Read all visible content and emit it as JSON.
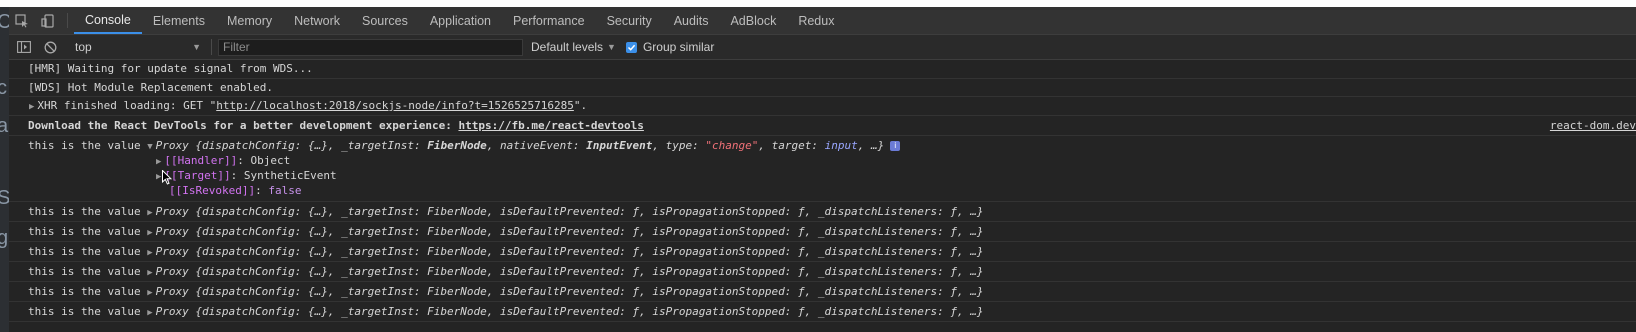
{
  "tabs": [
    "Console",
    "Elements",
    "Memory",
    "Network",
    "Sources",
    "Application",
    "Performance",
    "Security",
    "Audits",
    "AdBlock",
    "Redux"
  ],
  "toolbar": {
    "context": "top",
    "filter_placeholder": "Filter",
    "levels": "Default levels",
    "group_similar": "Group similar",
    "group_checked": true
  },
  "console": {
    "hmr": "[HMR] Waiting for update signal from WDS...",
    "wds": "[WDS] Hot Module Replacement enabled.",
    "xhr_prefix": "XHR finished loading: GET \"",
    "xhr_url": "http://localhost:2018/sockjs-node/info?t=1526525716285",
    "xhr_suffix": "\".",
    "devtools_text": "Download the React DevTools for a better development experience: ",
    "devtools_url": "https://fb.me/react-devtools",
    "devtools_source": "react-dom.dev",
    "value_label": "this is the value",
    "expanded": {
      "proxy": "Proxy",
      "preview": [
        {
          "k": "{dispatchConfig",
          "sep": ": ",
          "v": "{…}",
          "cls": "key"
        },
        {
          "k": ", _targetInst",
          "sep": ": ",
          "v": "FiberNode",
          "cls": "key"
        },
        {
          "k": ", nativeEvent",
          "sep": ": ",
          "v": "InputEvent",
          "cls": "key"
        },
        {
          "k": ", type",
          "sep": ": ",
          "v": "\"change\"",
          "cls": "str"
        },
        {
          "k": ", target",
          "sep": ": ",
          "v": "input",
          "cls": "tgt"
        },
        {
          "k": ", …}",
          "sep": "",
          "v": "",
          "cls": "key"
        }
      ],
      "children": [
        {
          "name": "[[Handler]]",
          "value": "Object",
          "has_arrow": true
        },
        {
          "name": "[[Target]]",
          "value": "SyntheticEvent",
          "has_arrow": true
        },
        {
          "name": "[[IsRevoked]]",
          "value": "false",
          "has_arrow": false
        }
      ]
    },
    "collapsed_preview": "{dispatchConfig: {…}, _targetInst: FiberNode, isDefaultPrevented: ƒ, isPropagationStopped: ƒ, _dispatchListeners: ƒ, …}",
    "collapsed_count": 6
  },
  "left_strip_glyphs": [
    "C",
    "c",
    "a",
    "S",
    "g"
  ],
  "colors": {
    "accent": "#3b8fe8",
    "background": "#242424",
    "internal_prop": "#d173f0",
    "string": "#f07178"
  }
}
